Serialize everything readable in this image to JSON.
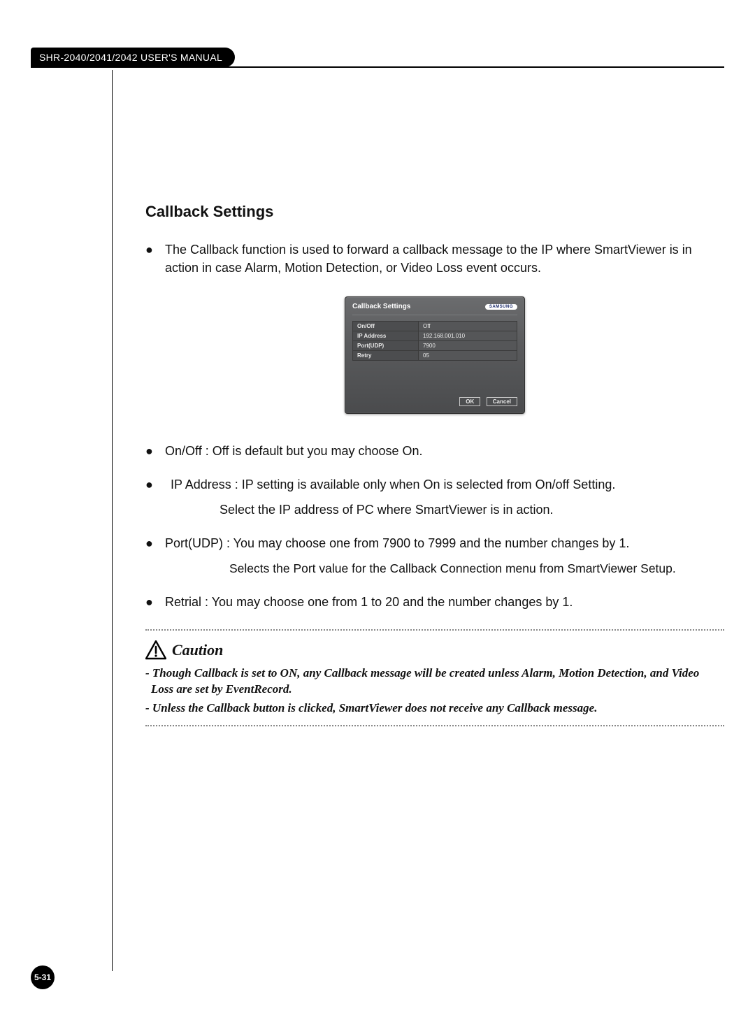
{
  "header": {
    "manual_title": "SHR-2040/2041/2042 USER'S MANUAL"
  },
  "section": {
    "title": "Callback Settings",
    "intro": "The Callback function is used to forward a callback message to the IP where SmartViewer is in action in case Alarm, Motion Detection, or Video Loss event occurs.",
    "onoff": "On/Off : Off is default but you may choose On.",
    "ip_line1": "IP Address : IP setting is available only when On is selected from On/off Setting.",
    "ip_line2": "Select the IP address of PC where SmartViewer is in action.",
    "port_line1": "Port(UDP) : You may choose one from 7900 to 7999 and the number changes by 1.",
    "port_line2": "Selects the Port value for the Callback Connection menu from SmartViewer Setup.",
    "retrial": "Retrial : You may choose one from 1 to 20 and the number changes by 1."
  },
  "dialog": {
    "title": "Callback Settings",
    "brand": "SAMSUNG",
    "rows": {
      "onoff_label": "On/Off",
      "onoff_value": "Off",
      "ip_label": "IP Address",
      "ip_value": "192.168.001.010",
      "port_label": "Port(UDP)",
      "port_value": "7900",
      "retry_label": "Retry",
      "retry_value": "05"
    },
    "ok": "OK",
    "cancel": "Cancel"
  },
  "caution": {
    "label": "Caution",
    "line1": "- Though Callback is set to ON, any Callback message will be created unless Alarm, Motion Detection, and Video Loss are set by EventRecord.",
    "line2": "- Unless the Callback button is clicked, SmartViewer does not receive any Callback message."
  },
  "page_number": "5-31"
}
